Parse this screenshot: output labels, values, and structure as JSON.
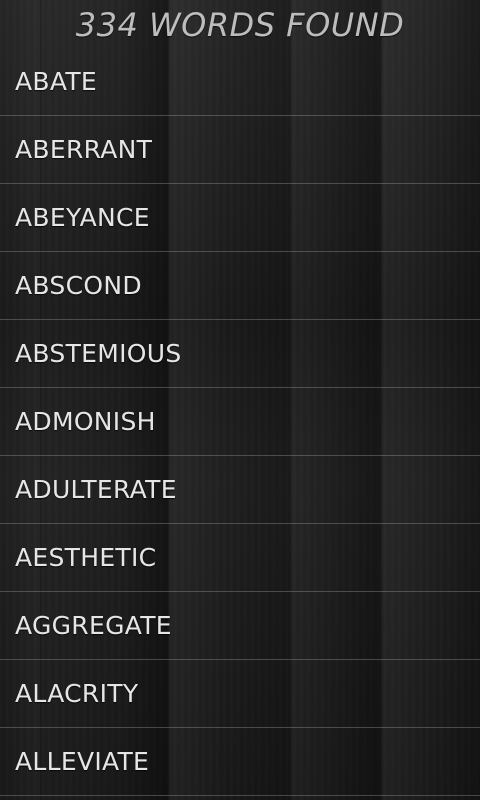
{
  "header": {
    "title": "334 WORDS FOUND"
  },
  "words": [
    "ABATE",
    "ABERRANT",
    "ABEYANCE",
    "ABSCOND",
    "ABSTEMIOUS",
    "ADMONISH",
    "ADULTERATE",
    "AESTHETIC",
    "AGGREGATE",
    "ALACRITY",
    "ALLEVIATE"
  ],
  "colors": {
    "background": "#1c1c1c",
    "title_text": "#bdbdbd",
    "word_text": "#e6e6e6",
    "divider": "#6a6a6a"
  }
}
